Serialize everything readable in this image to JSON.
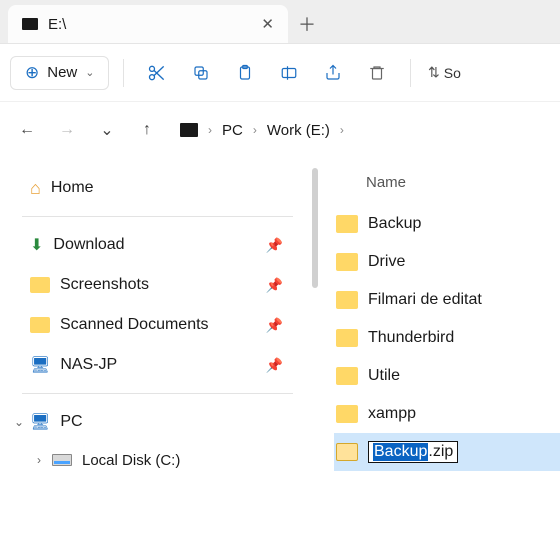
{
  "tab": {
    "title": "E:\\"
  },
  "toolbar": {
    "new_label": "New",
    "sort_label": "So"
  },
  "breadcrumb": {
    "root": "PC",
    "drive": "Work (E:)"
  },
  "sidebar": {
    "home": "Home",
    "quick": [
      {
        "label": "Download"
      },
      {
        "label": "Screenshots"
      },
      {
        "label": "Scanned Documents"
      },
      {
        "label": "NAS-JP"
      }
    ],
    "pc": "PC",
    "localdisk": "Local Disk (C:)"
  },
  "main": {
    "column": "Name",
    "items": [
      {
        "label": "Backup",
        "type": "folder"
      },
      {
        "label": "Drive",
        "type": "drivefolder"
      },
      {
        "label": "Filmari de editat",
        "type": "folder"
      },
      {
        "label": "Thunderbird",
        "type": "folder"
      },
      {
        "label": "Utile",
        "type": "folder"
      },
      {
        "label": "xampp",
        "type": "folder"
      }
    ],
    "rename": {
      "selected": "Backup",
      "rest": ".zip"
    }
  }
}
